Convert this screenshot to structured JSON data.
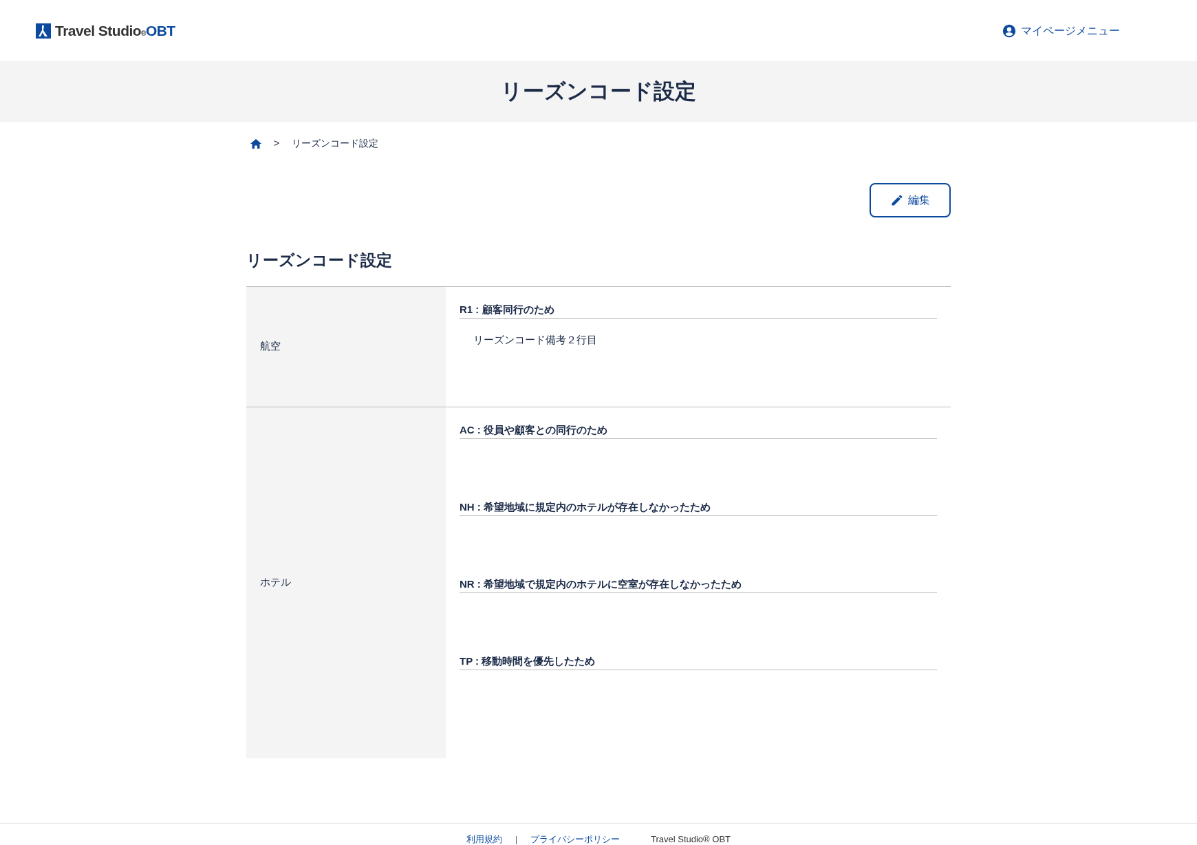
{
  "header": {
    "logo": {
      "text": "Travel Studio",
      "mark": "®",
      "suffix": "OBT"
    },
    "mypage_menu": "マイページメニュー"
  },
  "page_title": "リーズンコード設定",
  "breadcrumb": {
    "current": "リーズンコード設定",
    "separator": ">"
  },
  "edit_button": "編集",
  "section_title": "リーズンコード設定",
  "rows": [
    {
      "category": "航空",
      "codes": [
        {
          "label": "R1 : 顧客同行のため",
          "note": "リーズンコード備考２行目"
        }
      ]
    },
    {
      "category": "ホテル",
      "codes": [
        {
          "label": "AC : 役員や顧客との同行のため"
        },
        {
          "label": "NH : 希望地域に規定内のホテルが存在しなかったため"
        },
        {
          "label": "NR : 希望地域で規定内のホテルに空室が存在しなかったため"
        },
        {
          "label": "TP : 移動時間を優先したため"
        }
      ]
    }
  ],
  "footer": {
    "links": [
      "利用規約",
      "プライバシーポリシー"
    ],
    "copyright": "Travel Studio® OBT"
  }
}
